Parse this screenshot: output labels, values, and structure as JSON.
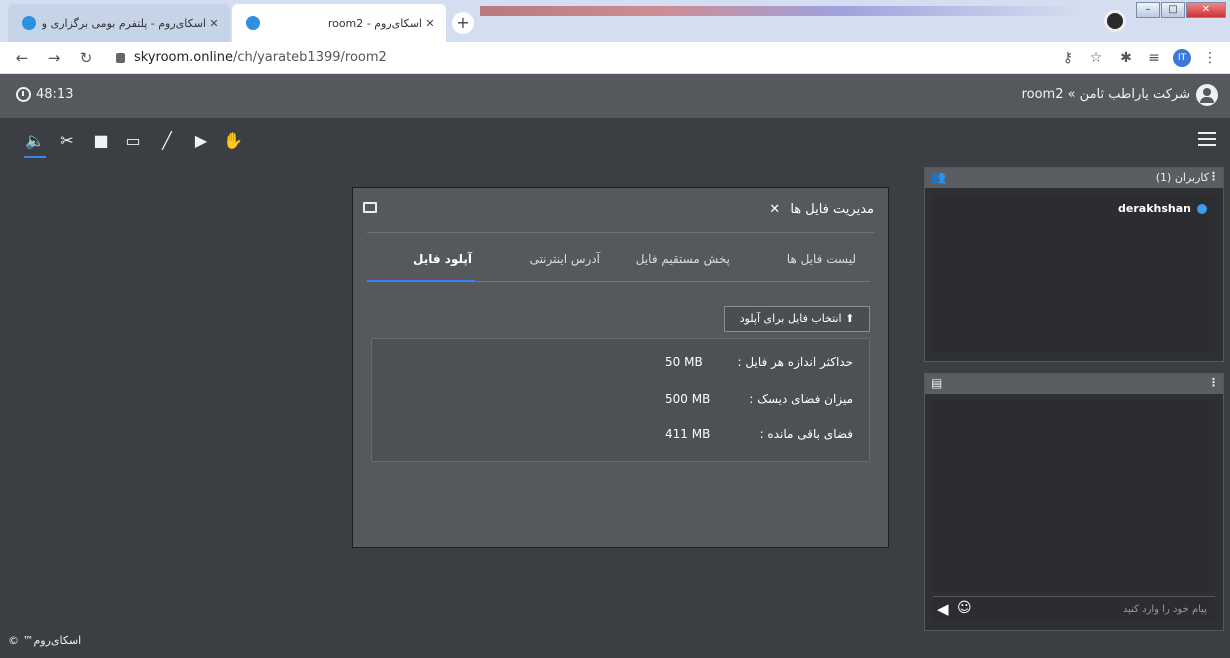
{
  "browser": {
    "tabs": [
      {
        "title": "اسکای‌روم - پلتفرم بومی برگزاری وبینار، آ",
        "active": false
      },
      {
        "title": "اسکای‌روم - room2",
        "active": true
      }
    ],
    "new_tab": "+",
    "url_host": "skyroom.online",
    "url_path": "/ch/yarateb1399/room2",
    "profile_initials": "IT"
  },
  "header": {
    "timer": "48:13",
    "room_title": "شرکت یاراطب ثامن » room2"
  },
  "toolbar": {
    "icons": [
      "speaker-icon",
      "mic-off-icon",
      "camera-icon",
      "screen-share-icon",
      "brush-icon",
      "play-icon",
      "raise-hand-icon"
    ]
  },
  "users_panel": {
    "title": "کاربران (1)",
    "users": [
      {
        "name": "derakhshan"
      }
    ]
  },
  "chat_panel": {
    "placeholder": "پیام خود را وارد کنید"
  },
  "dialog": {
    "title": "مدیریت فایل ها",
    "tabs": [
      {
        "label": "لیست فایل ها"
      },
      {
        "label": "پخش مستقیم فایل"
      },
      {
        "label": "آدرس اینترنتی"
      },
      {
        "label": "آپلود فایل"
      }
    ],
    "upload_button": "انتخاب فایل برای آپلود",
    "info": [
      {
        "label": "حداکثر اندازه هر فایل :",
        "value": "50 MB"
      },
      {
        "label": "میزان فضای دیسک :",
        "value": "500 MB"
      },
      {
        "label": "فضای باقی مانده :",
        "value": "411 MB"
      }
    ]
  },
  "footer": {
    "brand": "اسکای‌روم™ ©"
  }
}
